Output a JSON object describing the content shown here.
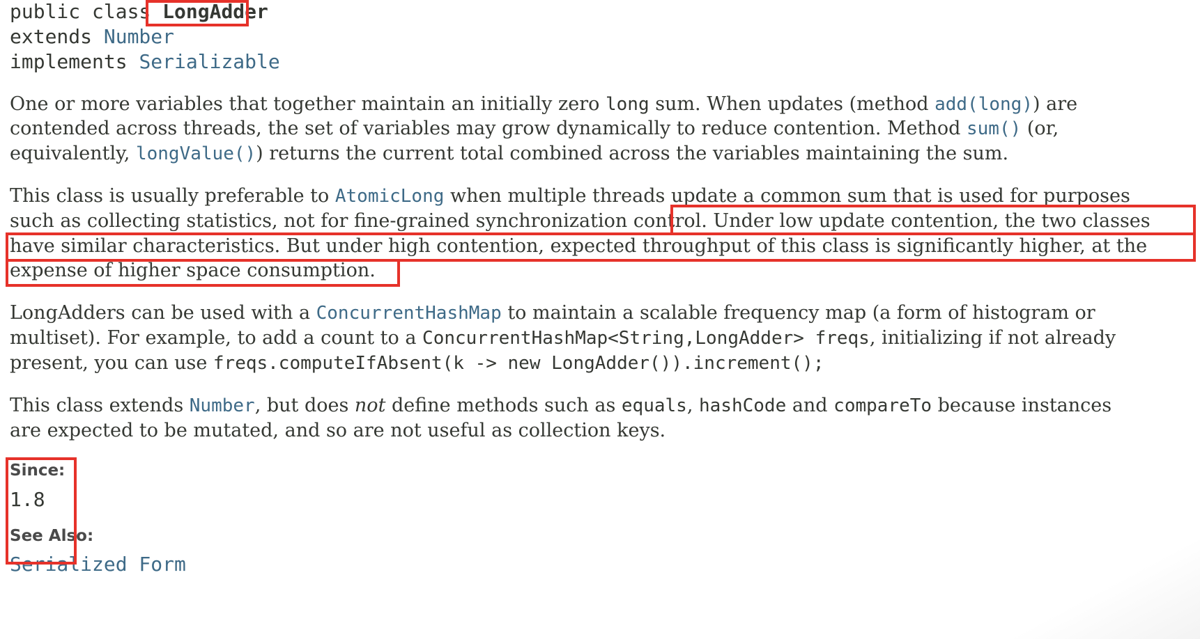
{
  "signature": {
    "prefix": "public class ",
    "class_name": "LongAdder",
    "extends_kw": "extends ",
    "extends_link": "Number",
    "implements_kw": "implements ",
    "implements_link": "Serializable"
  },
  "para1": {
    "l1a": "One or more variables that together maintain an initially zero ",
    "l1code": "long",
    "l1b": " sum. When updates (method ",
    "l1link": "add(long)",
    "l1c": ") are",
    "l2a": "contended across threads, the set of variables may grow dynamically to reduce contention. Method ",
    "l2link": "sum()",
    "l2b": " (or,",
    "l3a": "equivalently, ",
    "l3link": "longValue()",
    "l3b": ") returns the current total combined across the variables maintaining the sum."
  },
  "para2": {
    "l1a": "This class is usually preferable to ",
    "l1link": "AtomicLong",
    "l1b": " when multiple threads update a common sum that is used for purposes",
    "l2a": "such as collecting statistics, not for fine-grained synchronization control. ",
    "l2b": "Under low update contention, the two classes",
    "l3": "have similar characteristics. But under high contention, expected throughput of this class is significantly higher, at the",
    "l4": "expense of higher space consumption."
  },
  "para3": {
    "l1a": "LongAdders can be used with a ",
    "l1link": "ConcurrentHashMap",
    "l1b": " to maintain a scalable frequency map (a form of histogram or",
    "l2a": "multiset). For example, to add a count to a ",
    "l2code": "ConcurrentHashMap<String,LongAdder> freqs",
    "l2b": ", initializing if not already",
    "l3a": "present, you can use ",
    "l3code": "freqs.computeIfAbsent(k -> new LongAdder()).increment();"
  },
  "para4": {
    "l1a": "This class extends ",
    "l1link": "Number",
    "l1b": ", but does ",
    "l1em": "not",
    "l1c": " define methods such as ",
    "l1code1": "equals",
    "l1d": ", ",
    "l1code2": "hashCode",
    "l1e": " and ",
    "l1code3": "compareTo",
    "l1f": " because instances",
    "l2": "are expected to be mutated, and so are not useful as collection keys."
  },
  "since": {
    "label": "Since:",
    "value": "1.8"
  },
  "see_also": {
    "label": "See Also:",
    "link": "Serialized Form"
  },
  "colors": {
    "highlight": "#e6322a",
    "link": "#3e6a87",
    "text": "#353833"
  }
}
